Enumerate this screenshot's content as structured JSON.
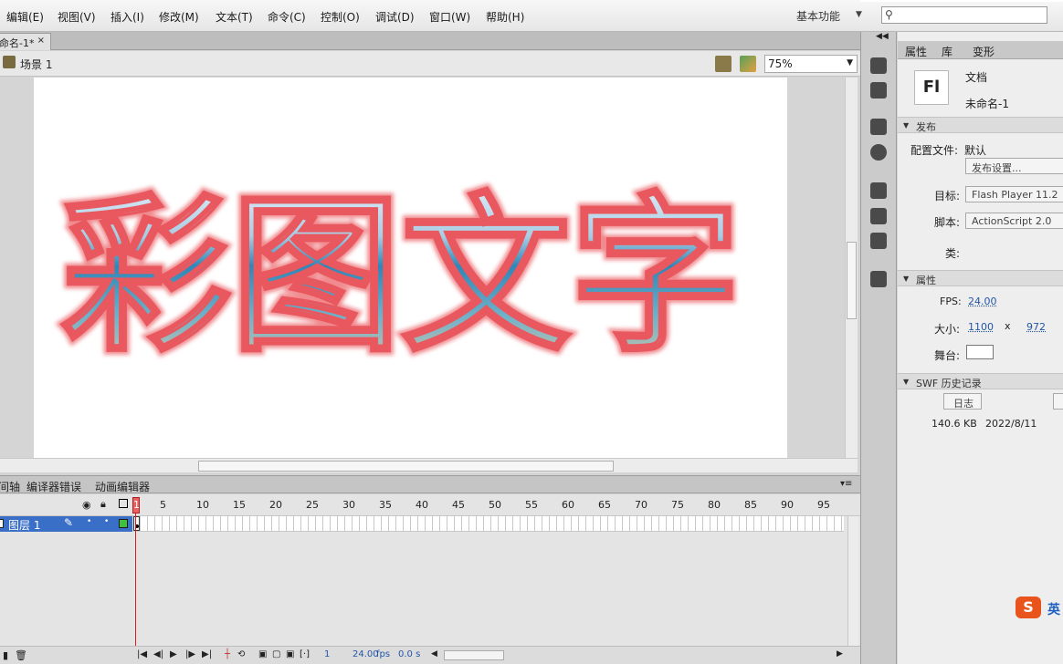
{
  "menubar": {
    "items": [
      "编辑(E)",
      "视图(V)",
      "插入(I)",
      "修改(M)",
      "文本(T)",
      "命令(C)",
      "控制(O)",
      "调试(D)",
      "窗口(W)",
      "帮助(H)"
    ],
    "workspace": "基本功能"
  },
  "document": {
    "tab_title": "命名-1*",
    "close": "×",
    "scene": "场景 1",
    "zoom": "75%"
  },
  "stage": {
    "text": "彩图文字",
    "stroke_color": "#e8585e"
  },
  "timeline": {
    "tabs": [
      "时间轴",
      "编译器错误",
      "动画编辑器"
    ],
    "frame_numbers": [
      "1",
      "5",
      "10",
      "15",
      "20",
      "25",
      "30",
      "35",
      "40",
      "45",
      "50",
      "55",
      "60",
      "65",
      "70",
      "75",
      "80",
      "85",
      "90",
      "95"
    ],
    "layer_name": "图层 1",
    "footer": {
      "current_frame": "1",
      "fps": "24.00",
      "fps_unit": "fps",
      "time": "0.0 s"
    }
  },
  "properties": {
    "tabs": [
      "属性",
      "库",
      "变形"
    ],
    "fl_icon": "Fl",
    "doc_type": "文档",
    "doc_name": "未命名-1",
    "publish_section": "发布",
    "profile_label": "配置文件:",
    "profile_value": "默认",
    "publish_settings_btn": "发布设置...",
    "target_label": "目标:",
    "target_value": "Flash Player 11.2",
    "script_label": "脚本:",
    "script_value": "ActionScript 2.0",
    "class_label": "类:",
    "props_section": "属性",
    "fps_label": "FPS:",
    "fps_value": "24.00",
    "size_label": "大小:",
    "width": "1100",
    "x": "x",
    "height": "972",
    "stage_label": "舞台:",
    "swf_section": "SWF 历史记录",
    "log_btn": "日志",
    "swf_size": "140.6 KB",
    "swf_date": "2022/8/11"
  },
  "ime": {
    "letter": "S",
    "label": "英"
  }
}
